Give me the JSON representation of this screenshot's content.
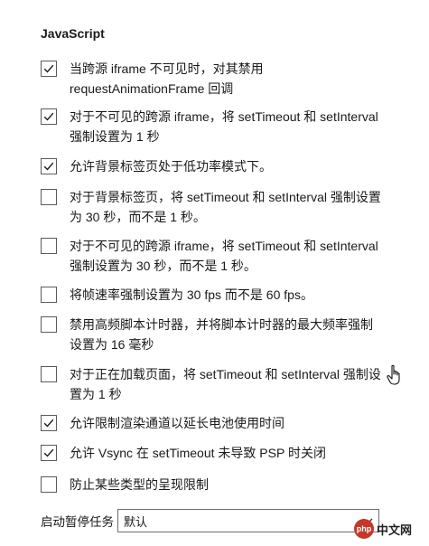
{
  "section_title": "JavaScript",
  "options": [
    {
      "checked": true,
      "label": "当跨源 iframe 不可见时，对其禁用\nrequestAnimationFrame 回调"
    },
    {
      "checked": true,
      "label": "对于不可见的跨源 iframe，将 setTimeout 和 setInterval\n强制设置为 1 秒"
    },
    {
      "checked": true,
      "label": "允许背景标签页处于低功率模式下。"
    },
    {
      "checked": false,
      "label": "对于背景标签页，将 setTimeout 和 setInterval 强制设置\n为 30 秒，而不是 1 秒。"
    },
    {
      "checked": false,
      "label": "对于不可见的跨源 iframe，将 setTimeout 和 setInterval\n强制设置为 30 秒，而不是 1 秒。"
    },
    {
      "checked": false,
      "label": "将帧速率强制设置为 30 fps 而不是 60 fps。"
    },
    {
      "checked": false,
      "label": "禁用高频脚本计时器，并将脚本计时器的最大频率强制\n设置为 16 毫秒"
    },
    {
      "checked": false,
      "label": "对于正在加载页面，将 setTimeout 和 setInterval 强制设\n置为 1 秒"
    },
    {
      "checked": true,
      "label": "允许限制渲染通道以延长电池使用时间"
    },
    {
      "checked": true,
      "label": "允许 Vsync 在 setTimeout 未导致 PSP 时关闭"
    },
    {
      "checked": false,
      "label": "防止某些类型的呈现限制"
    }
  ],
  "footer": {
    "label": "启动暂停任务",
    "select_value": "默认"
  },
  "watermark": {
    "logo_text": "php",
    "text": "中文网"
  },
  "colors": {
    "checkbox_border": "#5b5b5b",
    "check_mark": "#1a1a1a",
    "watermark_logo": "#c0392b"
  }
}
